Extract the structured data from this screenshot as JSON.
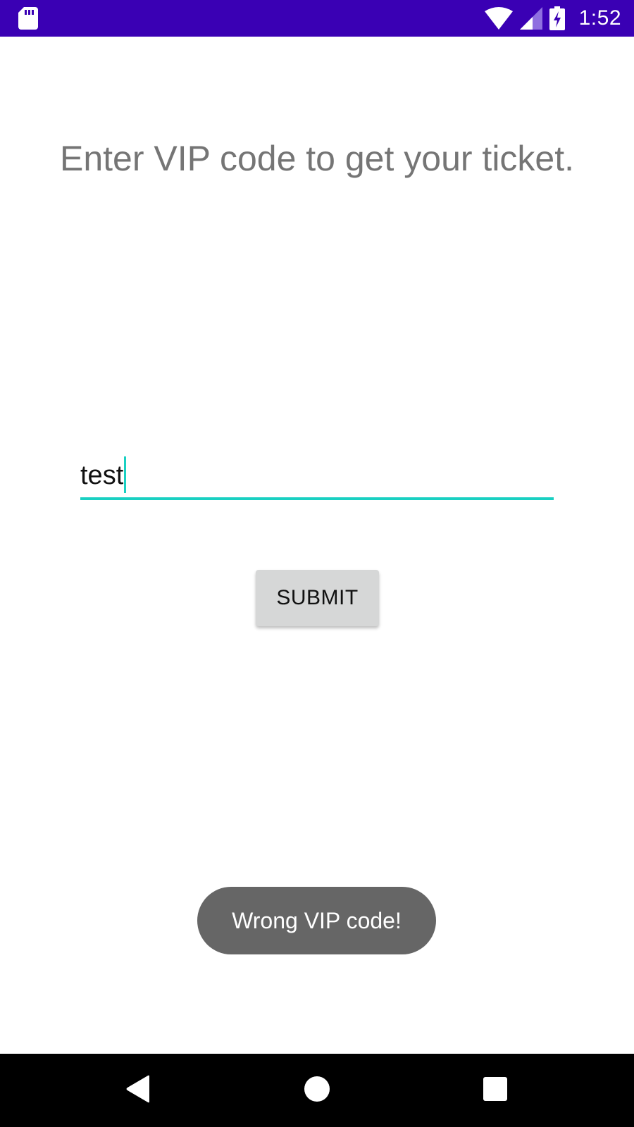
{
  "status_bar": {
    "time": "1:52",
    "icons": [
      "sd-card-icon",
      "wifi-icon",
      "cell-signal-icon",
      "battery-charging-icon"
    ],
    "background_color": "#3a00b4"
  },
  "main": {
    "prompt": "Enter VIP code to get your ticket.",
    "code_input": {
      "value": "test",
      "accent_color": "#19d0c2"
    },
    "submit_label": "SUBMIT"
  },
  "toast": {
    "message": "Wrong VIP code!"
  },
  "nav_bar": {
    "icons": [
      "back-icon",
      "home-icon",
      "recents-icon"
    ]
  }
}
